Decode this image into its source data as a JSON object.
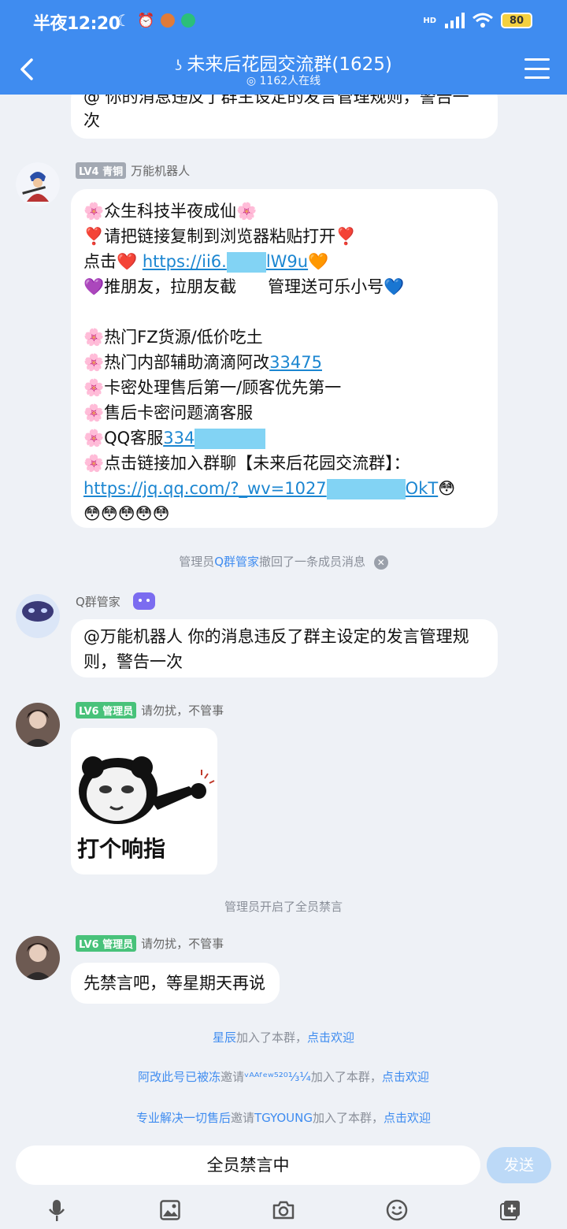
{
  "status_bar": {
    "time": "半夜12:20",
    "battery": "80",
    "network": "HD"
  },
  "header": {
    "title": "未来后花园交流群(1625)",
    "online": "1162人在线"
  },
  "messages": {
    "m0": {
      "text": "@ 你的消息违反了群主设定的发言管理规则，警告一次"
    },
    "m1": {
      "badge": "LV4 青铜",
      "sender": "万能机器人",
      "lines": [
        "🌸众生科技半夜成仙🌸",
        "❣️请把链接复制到浏览器粘贴打开❣️",
        "点击❤️",
        "https://ii6.",
        "lW9u",
        "🧡",
        "💜推朋友，拉朋友截",
        "管理送可乐小号💙",
        "🌸热门FZ货源/低价吃土",
        "🌸热门内部辅助滴滴阿改",
        "33475",
        "🌸卡密处理售后第一/顾客优先第一",
        "🌸售后卡密问题滴客服",
        "🌸QQ客服",
        "334",
        "🌸点击链接加入群聊【未来后花园交流群】：",
        "https://jq.qq.com/?_wv=1027",
        "OkT",
        "😳",
        "😳😳😳😳😳"
      ]
    },
    "sys1": {
      "prefix": "管理员",
      "name": "Q群管家",
      "suffix": "撤回了一条成员消息"
    },
    "m2": {
      "sender": "Q群管家",
      "text": "@万能机器人 你的消息违反了群主设定的发言管理规则，警告一次"
    },
    "m3": {
      "badge": "LV6 管理员",
      "sender": "请勿扰，不管事",
      "sticker_caption": "打个响指"
    },
    "sys2": {
      "text": "管理员开启了全员禁言"
    },
    "m4": {
      "badge": "LV6 管理员",
      "sender": "请勿扰，不管事",
      "text": "先禁言吧，等星期天再说"
    },
    "join1": {
      "name": "星辰",
      "middle": "加入了本群，",
      "action": "点击欢迎"
    },
    "join2": {
      "name": "阿改此号已被冻",
      "invite": "邀请",
      "invitee": "ᵛᴬᴬᶠᵉʷ⁵²⁰⅓¼",
      "middle": "加入了本群，",
      "action": "点击欢迎"
    },
    "join3": {
      "name": "专业解决一切售后",
      "invite": "邀请",
      "invitee": "TGYOUNG",
      "middle": "加入了本群，",
      "action": "点击欢迎"
    }
  },
  "input": {
    "placeholder": "全员禁言中",
    "send": "发送"
  },
  "colors": {
    "primary": "#3f8cf0",
    "background": "#eef1f6",
    "badge_green": "#48c27a",
    "badge_gray": "#a3a9b3"
  }
}
